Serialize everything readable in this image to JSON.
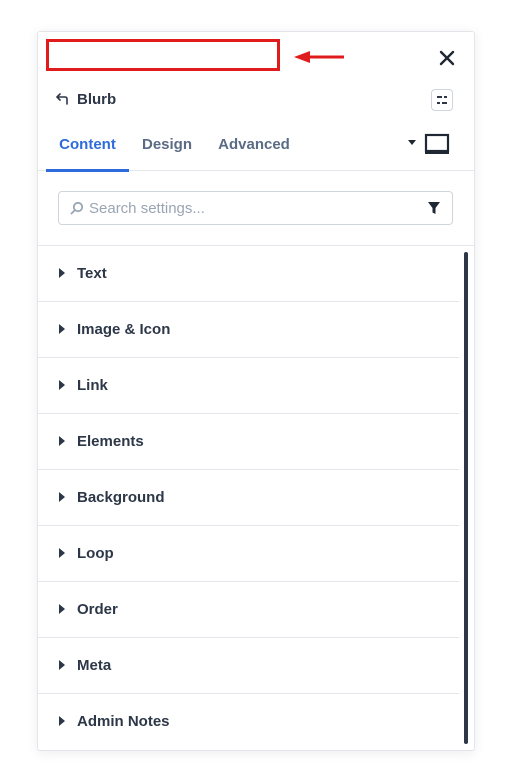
{
  "module": {
    "title": "Blurb"
  },
  "tabs": [
    {
      "label": "Content"
    },
    {
      "label": "Design"
    },
    {
      "label": "Advanced"
    }
  ],
  "search": {
    "placeholder": "Search settings...",
    "value": ""
  },
  "groups": [
    {
      "label": "Text"
    },
    {
      "label": "Image & Icon"
    },
    {
      "label": "Link"
    },
    {
      "label": "Elements"
    },
    {
      "label": "Background"
    },
    {
      "label": "Loop"
    },
    {
      "label": "Order"
    },
    {
      "label": "Meta"
    },
    {
      "label": "Admin Notes"
    }
  ],
  "colors": {
    "accent": "#2e6bdb",
    "annotation": "#e01b1b",
    "text": "#2d3748",
    "muted": "#5a6b85"
  },
  "icons": {
    "close": "close-icon",
    "back": "back-arrow-icon",
    "presets": "presets-icon",
    "view": "desktop-view-icon",
    "search": "search-icon",
    "filter": "filter-icon",
    "caret": "caret-right-icon"
  }
}
